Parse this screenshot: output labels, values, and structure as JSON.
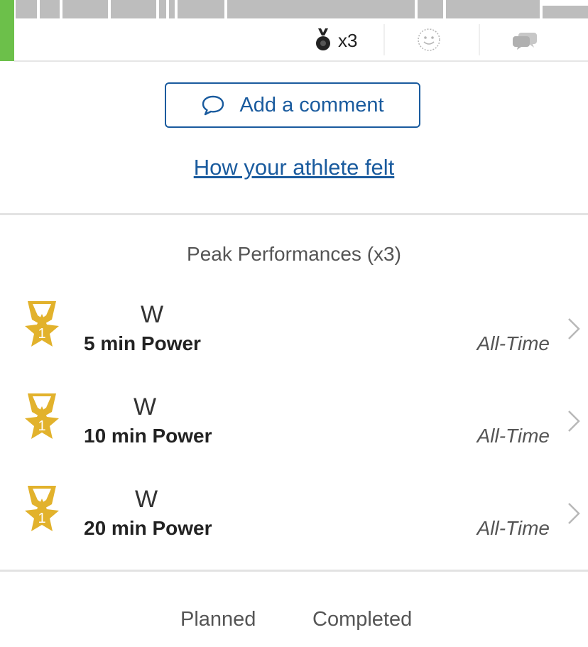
{
  "stats": {
    "medal_count": "x3",
    "icons": {
      "medal": "medal-icon",
      "feel": "smiley-icon",
      "comments": "chat-bubbles-icon"
    }
  },
  "actions": {
    "add_comment_label": "Add a comment",
    "how_felt_label": "How your athlete felt"
  },
  "peak_performances": {
    "title": "Peak Performances (x3)",
    "items": [
      {
        "rank": "1",
        "unit": "W",
        "name": "5 min Power",
        "period": "All-Time"
      },
      {
        "rank": "1",
        "unit": "W",
        "name": "10 min Power",
        "period": "All-Time"
      },
      {
        "rank": "1",
        "unit": "W",
        "name": "20 min Power",
        "period": "All-Time"
      }
    ]
  },
  "tabs": {
    "planned": "Planned",
    "completed": "Completed"
  },
  "colors": {
    "accent_blue": "#1a5b9e",
    "green_bar": "#6cc04a",
    "gold": "#e2b22c",
    "segment_gray": "#bdbdbd"
  }
}
